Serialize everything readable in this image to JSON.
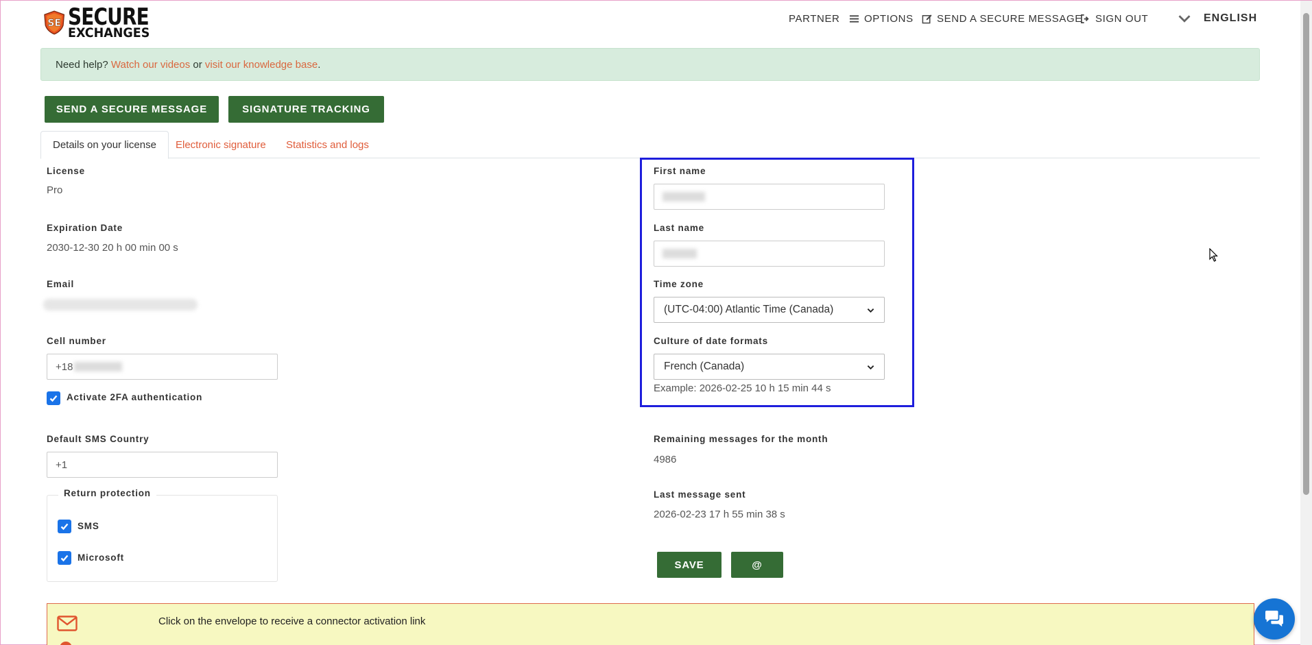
{
  "brand": {
    "line1": "SECURE",
    "line2": "EXCHANGES"
  },
  "topnav": {
    "partner": "PARTNER",
    "options": "OPTIONS",
    "send_message": "SEND A SECURE MESSAGE",
    "sign_out": "SIGN OUT",
    "language": "ENGLISH"
  },
  "help": {
    "prefix": "Need help?",
    "videos_link": "Watch our videos",
    "or": "or",
    "kb_link": "visit our knowledge base",
    "suffix": "."
  },
  "actions": {
    "send_secure_message": "SEND A SECURE MESSAGE",
    "signature_tracking": "SIGNATURE TRACKING"
  },
  "tabs": [
    {
      "label": "Details on your license",
      "active": true
    },
    {
      "label": "Electronic signature",
      "active": false
    },
    {
      "label": "Statistics and logs",
      "active": false
    }
  ],
  "left": {
    "license_label": "License",
    "license_value": "Pro",
    "expiration_label": "Expiration Date",
    "expiration_value": "2030-12-30 20 h 00 min 00 s",
    "email_label": "Email",
    "email_value": "",
    "cell_label": "Cell number",
    "cell_value": "+18",
    "twofa_label": "Activate 2FA authentication",
    "twofa_checked": true,
    "sms_country_label": "Default SMS Country",
    "sms_country_value": "+1",
    "return_protection_label": "Return protection",
    "sms_label": "SMS",
    "sms_checked": true,
    "microsoft_label": "Microsoft",
    "microsoft_checked": true
  },
  "right": {
    "first_name_label": "First name",
    "first_name_value": "",
    "last_name_label": "Last name",
    "last_name_value": "",
    "timezone_label": "Time zone",
    "timezone_value": "(UTC-04:00) Atlantic Time (Canada)",
    "culture_label": "Culture of date formats",
    "culture_value": "French (Canada)",
    "example_text": "Example: 2026-02-25 10 h 15 min 44 s",
    "remaining_label": "Remaining messages for the month",
    "remaining_value": "4986",
    "last_sent_label": "Last message sent",
    "last_sent_value": "2026-02-23 17 h 55 min 38 s",
    "save_label": "SAVE",
    "at_label": "@"
  },
  "bottom": {
    "connector_text": "Click on the envelope to receive a connector activation link"
  },
  "colors": {
    "green": "#356c35",
    "link": "#d9673e",
    "highlight": "#1e1edc",
    "help_bg": "#d7ecdd",
    "chat": "#1674d4"
  }
}
